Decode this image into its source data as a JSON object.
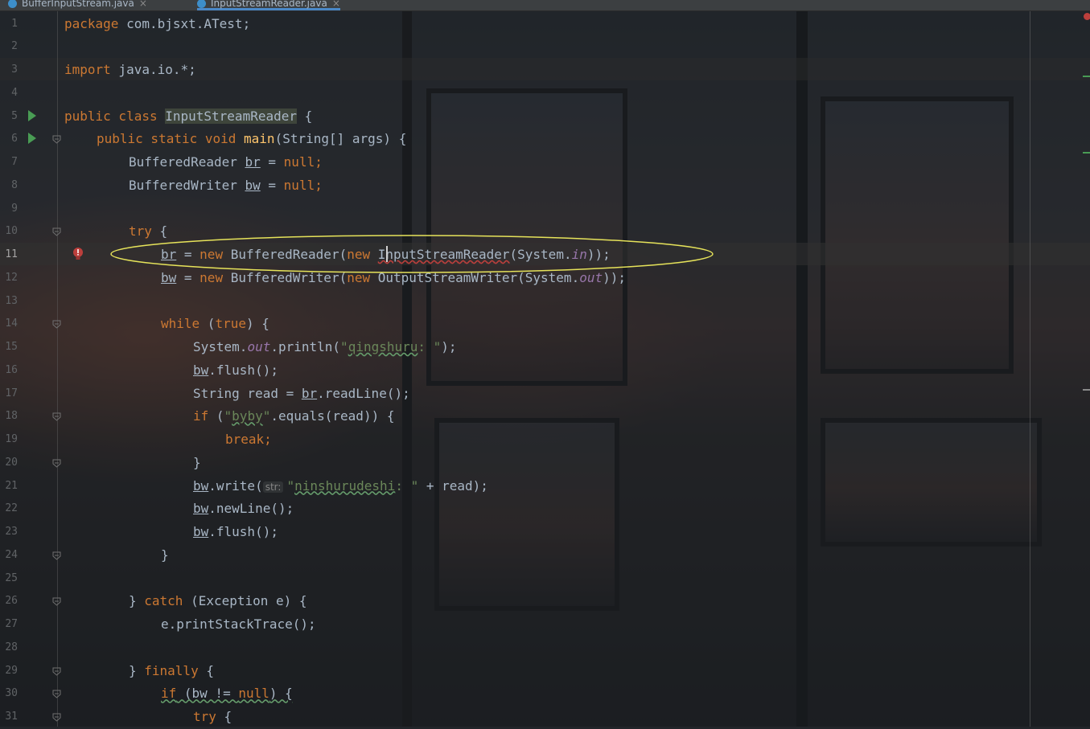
{
  "tabs": [
    {
      "label": "BufferInputStream.java",
      "active": false
    },
    {
      "label": "InputStreamReader.java",
      "active": true
    }
  ],
  "editor": {
    "current_line": 11,
    "line_numbers": [
      "1",
      "2",
      "3",
      "4",
      "5",
      "6",
      "7",
      "8",
      "9",
      "10",
      "11",
      "12",
      "13",
      "14",
      "15",
      "16",
      "17",
      "18",
      "19",
      "20",
      "21",
      "22",
      "23",
      "24",
      "25",
      "26",
      "27",
      "28",
      "29",
      "30",
      "31"
    ],
    "inlay_hint": "str:",
    "run_lines": [
      5,
      6
    ],
    "fold_lines": [
      6,
      10,
      14,
      18,
      20,
      24,
      26,
      29,
      30,
      31
    ],
    "breakpoint_line": 11
  },
  "colors": {
    "keyword": "#cc7832",
    "string": "#6a8759",
    "method": "#ffc66d",
    "field": "#9876aa",
    "text": "#a9b7c6",
    "annotation_ellipse": "#e6e35a",
    "error": "#bc3f3c"
  },
  "code": {
    "l1": {
      "k": "package",
      "t": " com.bjsxt.ATest;"
    },
    "l3": {
      "k": "import",
      "t": " java.io.*;"
    },
    "l5": {
      "k": "public class ",
      "cls": "InputStreamReader",
      "t": " {"
    },
    "l6": {
      "k": "public static void ",
      "fn": "main",
      "t": "(String[] args) {"
    },
    "l7": {
      "t1": "BufferedReader ",
      "v": "br",
      "t2": " = ",
      "k": "null",
      "t3": ";"
    },
    "l8": {
      "t1": "BufferedWriter ",
      "v": "bw",
      "t2": " = ",
      "k": "null",
      "t3": ";"
    },
    "l10": {
      "k": "try",
      "t": " {"
    },
    "l11": {
      "v": "br",
      "t1": " = ",
      "k1": "new",
      "t2": " BufferedReader(",
      "k2": "new",
      "t3": " ",
      "e": "InputStreamReader",
      "t4": "(System.",
      "f": "in",
      "t5": "));"
    },
    "l12": {
      "v": "bw",
      "t1": " = ",
      "k1": "new",
      "t2": " BufferedWriter(",
      "k2": "new",
      "t3": " OutputStreamWriter(System.",
      "f": "out",
      "t4": "));"
    },
    "l14": {
      "k1": "while",
      "t1": " (",
      "k2": "true",
      "t2": ") {"
    },
    "l15": {
      "t1": "System.",
      "f": "out",
      "t2": ".println(",
      "s1": "\"",
      "s2": "qingshuru",
      "s3": ": \"",
      "t3": ");"
    },
    "l16": {
      "v": "bw",
      "t": ".flush();"
    },
    "l17": {
      "t1": "String read = ",
      "v": "br",
      "t2": ".readLine();"
    },
    "l18": {
      "k": "if",
      "t1": " (",
      "s1": "\"",
      "s2": "byby",
      "s3": "\"",
      "t2": ".equals(read)) {"
    },
    "l19": {
      "k": "break",
      "t": ";"
    },
    "l20": {
      "t": "}"
    },
    "l21": {
      "v": "bw",
      "t1": ".write(",
      "s1": "\"",
      "s2": "ninshurudeshi",
      "s3": ": \"",
      "t2": " + read);"
    },
    "l22": {
      "v": "bw",
      "t": ".newLine();"
    },
    "l23": {
      "v": "bw",
      "t": ".flush();"
    },
    "l24": {
      "t": "}"
    },
    "l26": {
      "t1": "} ",
      "k": "catch",
      "t2": " (Exception e) {"
    },
    "l27": {
      "t": "e.printStackTrace();"
    },
    "l29": {
      "t1": "} ",
      "k": "finally",
      "t2": " {"
    },
    "l30": {
      "k1": "if",
      "t1": " (bw != ",
      "k2": "null",
      "t2": ") {"
    },
    "l31": {
      "k": "try",
      "t": " {"
    }
  }
}
